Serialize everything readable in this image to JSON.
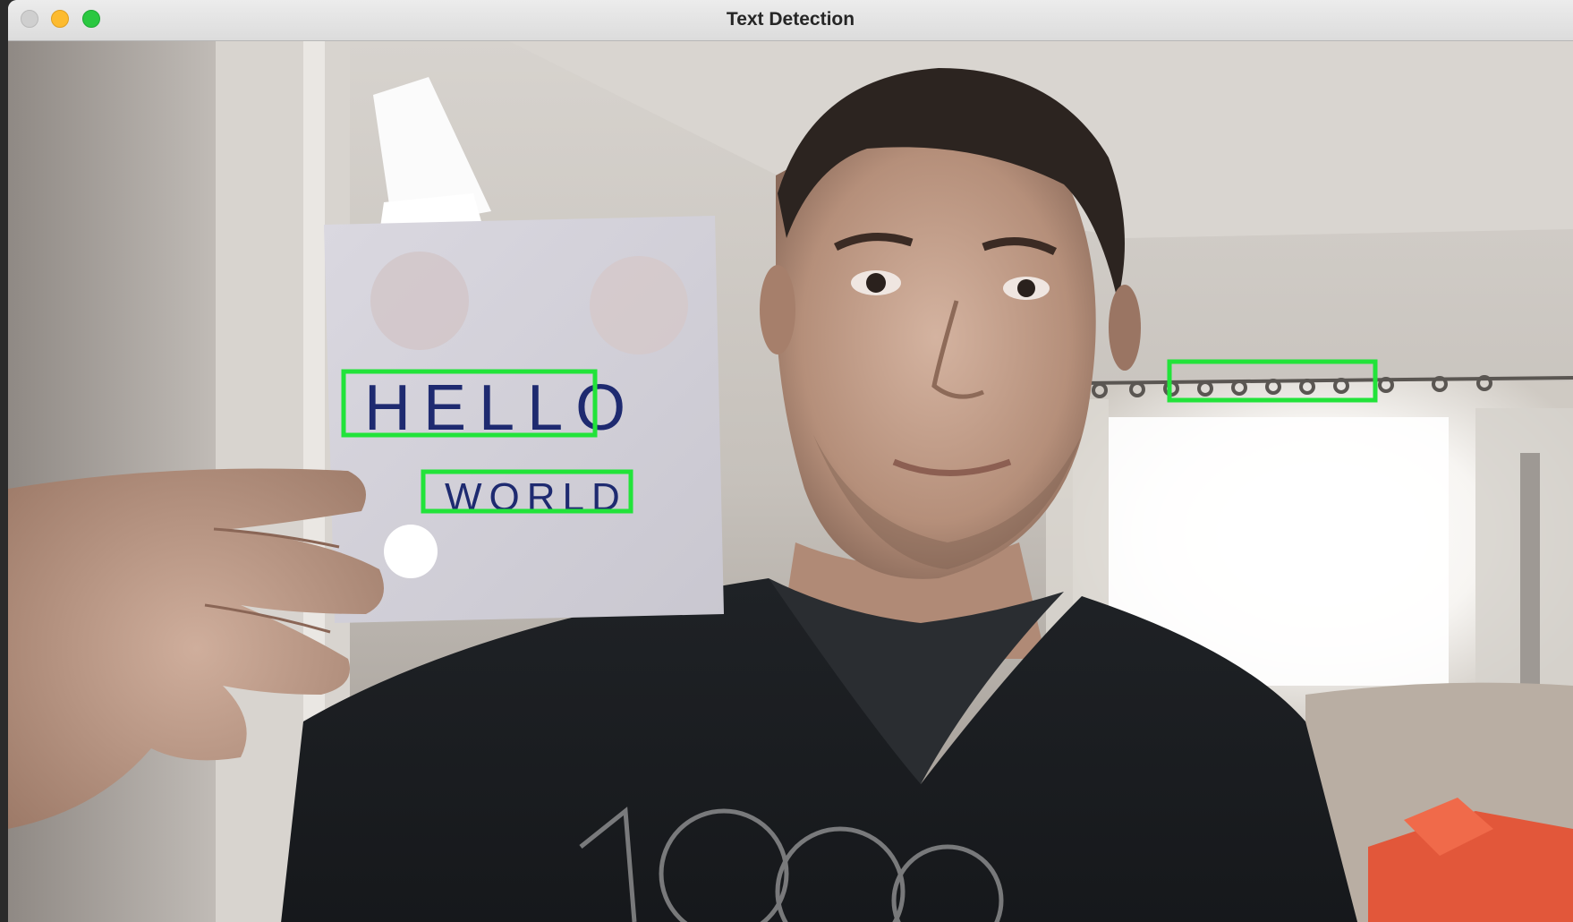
{
  "window": {
    "title": "Text Detection",
    "controls": {
      "close": "close-button",
      "minimize": "minimize-button",
      "zoom": "zoom-button"
    }
  },
  "camera_frame": {
    "paper_text_lines": [
      "HELLO",
      "WORLD"
    ],
    "detection_box_color": "#22e33a",
    "detections": 3
  }
}
